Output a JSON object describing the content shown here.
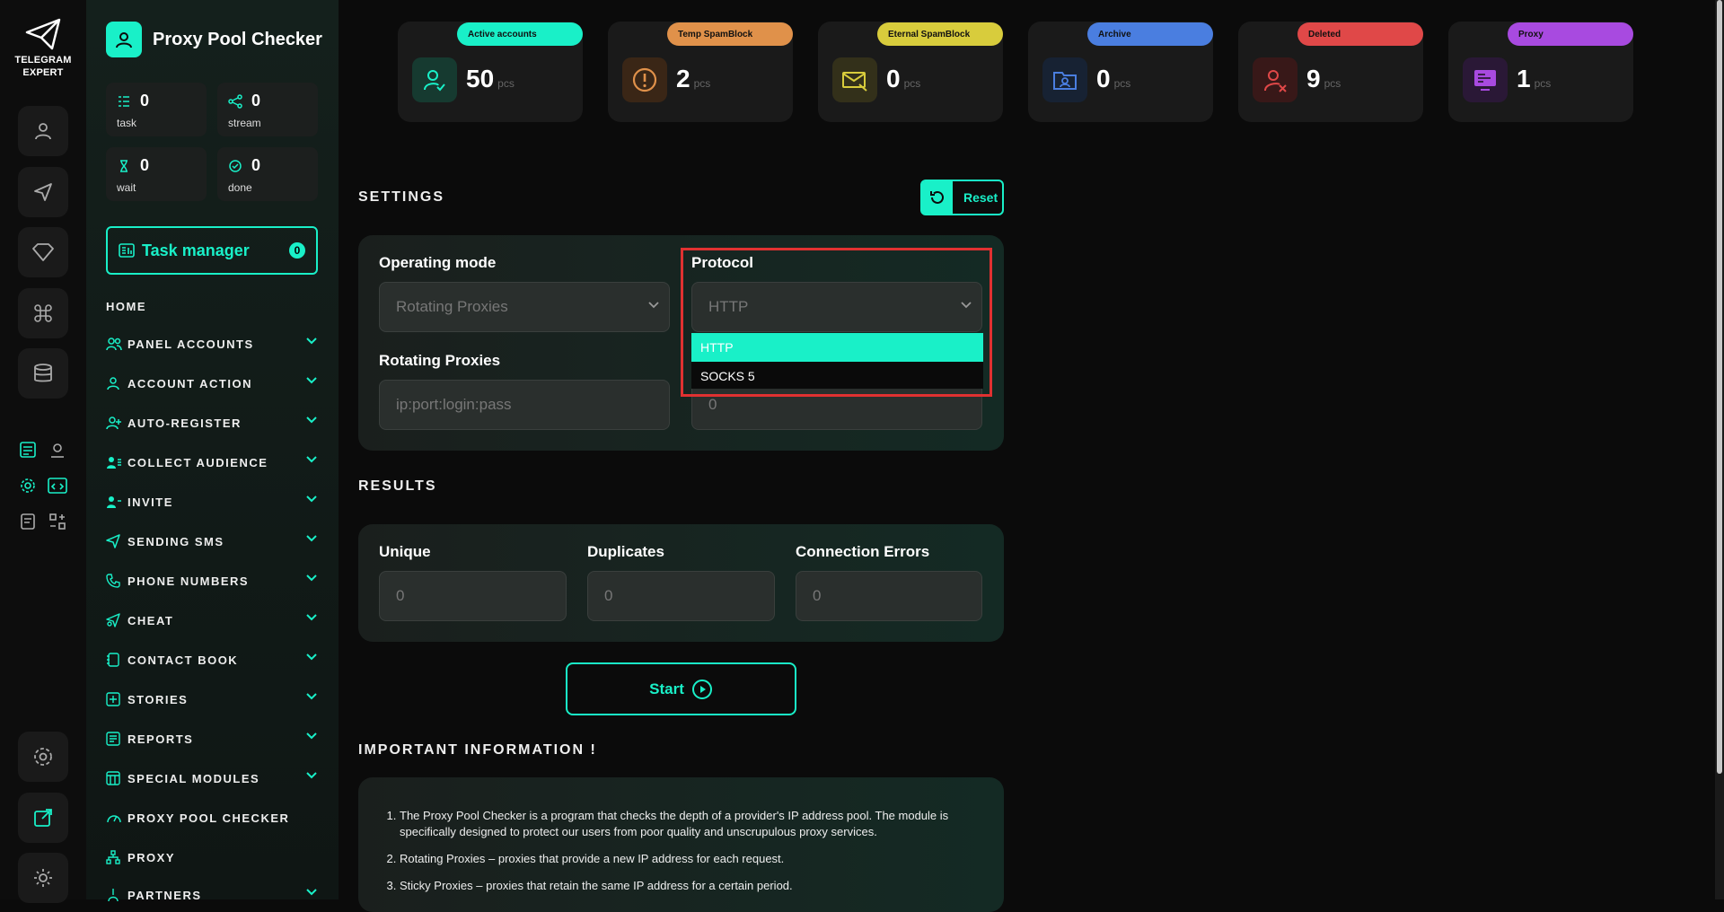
{
  "logo": {
    "line1": "TELEGRAM",
    "line2": "EXPERT"
  },
  "brand": {
    "title": "Proxy Pool Checker"
  },
  "stats": [
    {
      "value": "0",
      "label": "task"
    },
    {
      "value": "0",
      "label": "stream"
    },
    {
      "value": "0",
      "label": "wait"
    },
    {
      "value": "0",
      "label": "done"
    }
  ],
  "task_manager": {
    "label": "Task manager",
    "count": "0"
  },
  "nav": {
    "home": "HOME",
    "items": [
      {
        "label": "PANEL ACCOUNTS"
      },
      {
        "label": "ACCOUNT ACTION"
      },
      {
        "label": "AUTO-REGISTER"
      },
      {
        "label": "COLLECT AUDIENCE"
      },
      {
        "label": "INVITE"
      },
      {
        "label": "SENDING SMS"
      },
      {
        "label": "PHONE NUMBERS"
      },
      {
        "label": "CHEAT"
      },
      {
        "label": "CONTACT BOOK"
      },
      {
        "label": "STORIES"
      },
      {
        "label": "REPORTS"
      },
      {
        "label": "SPECIAL MODULES"
      },
      {
        "label": "PROXY POOL CHECKER"
      },
      {
        "label": "PROXY"
      },
      {
        "label": "PARTNERS"
      }
    ]
  },
  "cards": [
    {
      "label": "Active accounts",
      "value": "50",
      "unit": "pcs",
      "color": "#19f0c8"
    },
    {
      "label": "Temp SpamBlock",
      "value": "2",
      "unit": "pcs",
      "color": "#e0914a"
    },
    {
      "label": "Eternal SpamBlock",
      "value": "0",
      "unit": "pcs",
      "color": "#d8cc3c"
    },
    {
      "label": "Archive",
      "value": "0",
      "unit": "pcs",
      "color": "#4a7ee0"
    },
    {
      "label": "Deleted",
      "value": "9",
      "unit": "pcs",
      "color": "#e04848"
    },
    {
      "label": "Proxy",
      "value": "1",
      "unit": "pcs",
      "color": "#a84ae0"
    }
  ],
  "settings": {
    "title": "SETTINGS",
    "reset_label": "Reset",
    "operating_mode_label": "Operating mode",
    "operating_mode_value": "Rotating Proxies",
    "protocol_label": "Protocol",
    "protocol_value": "HTTP",
    "protocol_options": [
      "HTTP",
      "SOCKS 5"
    ],
    "rotating_label": "Rotating Proxies",
    "rotating_placeholder": "ip:port:login:pass",
    "requests_value": "0"
  },
  "results": {
    "title": "RESULTS",
    "unique_label": "Unique",
    "unique_value": "0",
    "duplicates_label": "Duplicates",
    "duplicates_value": "0",
    "errors_label": "Connection Errors",
    "errors_value": "0"
  },
  "start_label": "Start",
  "info": {
    "title": "IMPORTANT INFORMATION !",
    "items": [
      "The Proxy Pool Checker is a program that checks the depth of a provider's IP address pool. The module is specifically designed to protect our users from poor quality and unscrupulous proxy services.",
      "Rotating Proxies – proxies that provide a new IP address for each request.",
      "Sticky Proxies – proxies that retain the same IP address for a certain period."
    ]
  },
  "accent_color": "#19f0c8"
}
